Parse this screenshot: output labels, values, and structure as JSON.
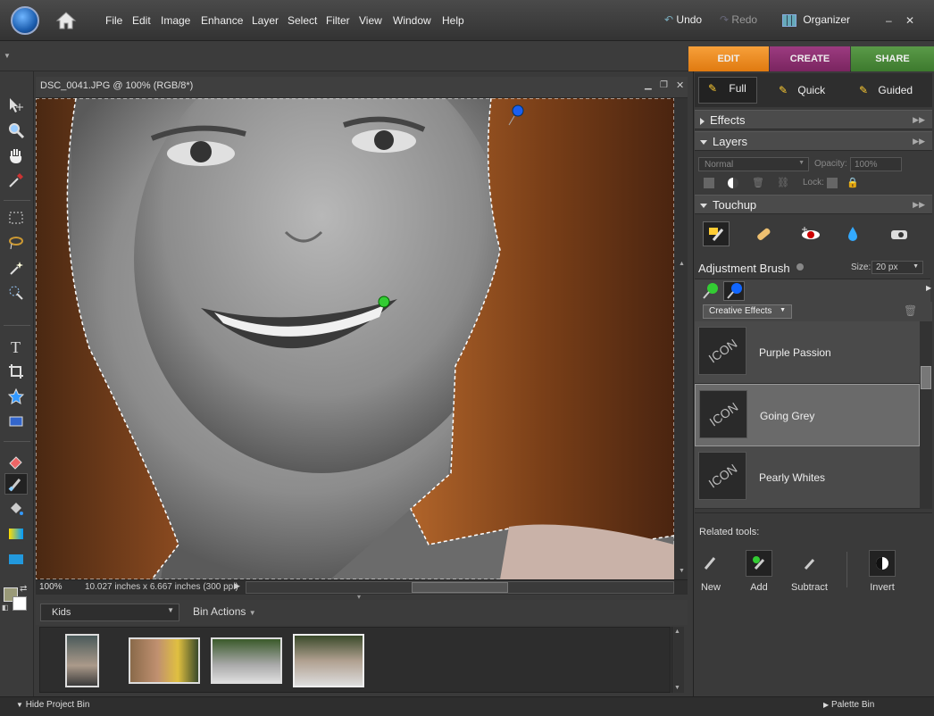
{
  "menu": [
    "File",
    "Edit",
    "Image",
    "Enhance",
    "Layer",
    "Select",
    "Filter",
    "View",
    "Window",
    "Help"
  ],
  "toolbar": {
    "undo": "Undo",
    "redo": "Redo",
    "organizer": "Organizer",
    "minimize": "–",
    "maximize": "□",
    "close": "✕"
  },
  "modes": {
    "edit": "EDIT",
    "create": "CREATE",
    "share": "SHARE"
  },
  "document": {
    "title": "DSC_0041.JPG @ 100% (RGB/8*)",
    "zoom": "100%",
    "info": "10.027 inches x 6.667 inches (300 ppi)"
  },
  "panel": {
    "tabs": {
      "full": "Full",
      "quick": "Quick",
      "guided": "Guided"
    },
    "effects": "Effects",
    "layers": "Layers",
    "blend_mode": "Normal",
    "opacity_label": "Opacity:",
    "opacity_value": "100%",
    "lock_label": "Lock:",
    "touchup": "Touchup",
    "adjustment_brush": "Adjustment Brush",
    "size_label": "Size:",
    "size_value": "20 px",
    "effect_category": "Creative Effects",
    "effects_list": [
      {
        "name": "Purple Passion",
        "icon": "ICON"
      },
      {
        "name": "Going Grey",
        "icon": "ICON"
      },
      {
        "name": "Pearly Whites",
        "icon": "ICON"
      }
    ],
    "related_tools_label": "Related tools:",
    "related_tools": [
      "New",
      "Add",
      "Subtract",
      "Invert"
    ]
  },
  "bin": {
    "album": "Kids",
    "actions": "Bin Actions"
  },
  "bottom": {
    "hide_bin": "Hide Project Bin",
    "palette_bin": "Palette Bin"
  },
  "colors": {
    "edit_tab": "#f08a1c",
    "create_tab": "#8b2f6f",
    "share_tab": "#4a8a3a"
  }
}
